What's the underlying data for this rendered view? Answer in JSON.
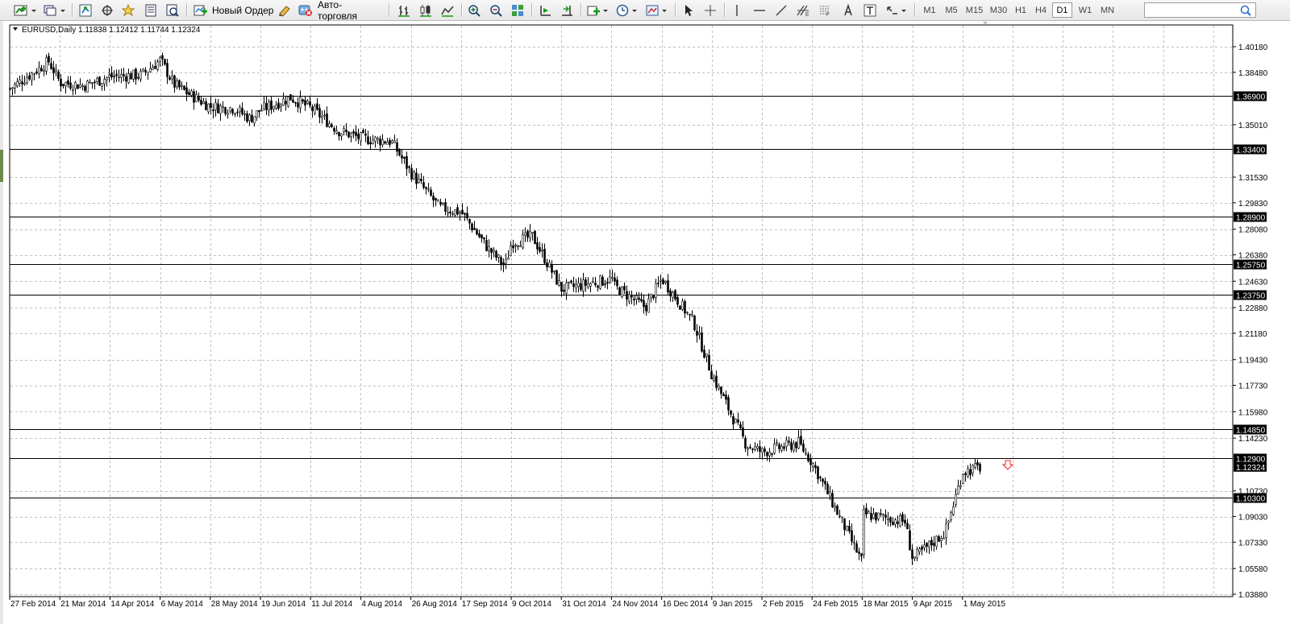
{
  "toolbar": {
    "new_order_label": "Новый Ордер",
    "autotrading_label": "Авто-торговля",
    "timeframes": [
      "M1",
      "M5",
      "M15",
      "M30",
      "H1",
      "H4",
      "D1",
      "W1",
      "MN"
    ],
    "active_timeframe": "D1",
    "icons": [
      "new-chart-icon",
      "profiles-icon",
      "market-watch-icon",
      "navigator-icon",
      "favorites-icon",
      "data-window-icon",
      "strategy-tester-icon",
      "new-order-icon",
      "metaeditor-icon",
      "autotrading-icon",
      "bar-chart-icon",
      "candlestick-icon",
      "line-chart-icon",
      "zoom-in-icon",
      "zoom-out-icon",
      "tile-windows-icon",
      "chart-shift-icon",
      "autoscroll-icon",
      "indicators-icon",
      "periods-icon",
      "templates-icon",
      "cursor-icon",
      "crosshair-icon",
      "vertical-line-icon",
      "horizontal-line-icon",
      "trendline-icon",
      "fibonacci-icon",
      "gridlines-icon",
      "text-icon",
      "text-label-icon",
      "arrows-icon",
      "search-icon"
    ]
  },
  "chart": {
    "symbol_info": "EURUSD,Daily  1.11838 1.12412 1.11744 1.12324",
    "x_labels": [
      "27 Feb 2014",
      "21 Mar 2014",
      "14 Apr 2014",
      "6 May 2014",
      "28 May 2014",
      "19 Jun 2014",
      "11 Jul 2014",
      "4 Aug 2014",
      "26 Aug 2014",
      "17 Sep 2014",
      "9 Oct 2014",
      "31 Oct 2014",
      "24 Nov 2014",
      "16 Dec 2014",
      "9 Jan 2015",
      "2 Feb 2015",
      "24 Feb 2015",
      "18 Mar 2015",
      "9 Apr 2015",
      "1 May 2015"
    ],
    "current_price": "1.12324",
    "colors": {
      "candle": "#000000",
      "background": "#ffffff",
      "grid": "#c0c0c0",
      "sell_arrow": "#ff0000"
    }
  },
  "chart_data": {
    "type": "candlestick",
    "symbol": "EURUSD",
    "timeframe": "Daily",
    "ohlc_last": {
      "open": 1.11838,
      "high": 1.12412,
      "low": 1.11744,
      "close": 1.12324
    },
    "ylim": [
      1.0388,
      1.4018
    ],
    "y_ticks": [
      1.4018,
      1.3848,
      1.3501,
      1.3153,
      1.2983,
      1.2808,
      1.2638,
      1.2463,
      1.2288,
      1.2118,
      1.1943,
      1.1773,
      1.1598,
      1.1423,
      1.1073,
      1.0903,
      1.0733,
      1.0558,
      1.0388
    ],
    "y_tick_labels": [
      "1.40180",
      "1.38480",
      "1.35010",
      "1.31530",
      "1.29830",
      "1.28080",
      "1.26380",
      "1.24630",
      "1.22880",
      "1.21180",
      "1.19430",
      "1.17730",
      "1.15980",
      "1.14230",
      "1.10730",
      "1.09030",
      "1.07330",
      "1.05580",
      "1.03880"
    ],
    "horizontal_levels": [
      1.369,
      1.334,
      1.289,
      1.2575,
      1.2375,
      1.1485,
      1.129,
      1.103
    ],
    "level_labels": [
      "1.36900",
      "1.33400",
      "1.28900",
      "1.25750",
      "1.23750",
      "1.14850",
      "1.12900",
      "1.10300"
    ],
    "close_path": [
      {
        "date": "27 Feb 2014",
        "close": 1.374
      },
      {
        "date": "14 Mar 2014",
        "close": 1.392
      },
      {
        "date": "21 Mar 2014",
        "close": 1.378
      },
      {
        "date": "1 Apr 2014",
        "close": 1.376
      },
      {
        "date": "14 Apr 2014",
        "close": 1.382
      },
      {
        "date": "24 Apr 2014",
        "close": 1.383
      },
      {
        "date": "6 May 2014",
        "close": 1.393
      },
      {
        "date": "9 May 2014",
        "close": 1.377
      },
      {
        "date": "19 May 2014",
        "close": 1.37
      },
      {
        "date": "28 May 2014",
        "close": 1.362
      },
      {
        "date": "6 Jun 2014",
        "close": 1.361
      },
      {
        "date": "12 Jun 2014",
        "close": 1.354
      },
      {
        "date": "19 Jun 2014",
        "close": 1.36
      },
      {
        "date": "1 Jul 2014",
        "close": 1.368
      },
      {
        "date": "11 Jul 2014",
        "close": 1.361
      },
      {
        "date": "23 Jul 2014",
        "close": 1.346
      },
      {
        "date": "4 Aug 2014",
        "close": 1.341
      },
      {
        "date": "15 Aug 2014",
        "close": 1.339
      },
      {
        "date": "26 Aug 2014",
        "close": 1.318
      },
      {
        "date": "5 Sep 2014",
        "close": 1.295
      },
      {
        "date": "17 Sep 2014",
        "close": 1.292
      },
      {
        "date": "26 Sep 2014",
        "close": 1.268
      },
      {
        "date": "3 Oct 2014",
        "close": 1.256
      },
      {
        "date": "9 Oct 2014",
        "close": 1.272
      },
      {
        "date": "17 Oct 2014",
        "close": 1.276
      },
      {
        "date": "31 Oct 2014",
        "close": 1.241
      },
      {
        "date": "14 Nov 2014",
        "close": 1.248
      },
      {
        "date": "24 Nov 2014",
        "close": 1.244
      },
      {
        "date": "5 Dec 2014",
        "close": 1.229
      },
      {
        "date": "16 Dec 2014",
        "close": 1.248
      },
      {
        "date": "26 Dec 2014",
        "close": 1.219
      },
      {
        "date": "9 Jan 2015",
        "close": 1.184
      },
      {
        "date": "22 Jan 2015",
        "close": 1.138
      },
      {
        "date": "2 Feb 2015",
        "close": 1.133
      },
      {
        "date": "16 Feb 2015",
        "close": 1.139
      },
      {
        "date": "24 Feb 2015",
        "close": 1.126
      },
      {
        "date": "11 Mar 2015",
        "close": 1.061
      },
      {
        "date": "18 Mar 2015",
        "close": 1.092
      },
      {
        "date": "26 Mar 2015",
        "close": 1.087
      },
      {
        "date": "9 Apr 2015",
        "close": 1.062
      },
      {
        "date": "17 Apr 2015",
        "close": 1.08
      },
      {
        "date": "1 May 2015",
        "close": 1.12
      },
      {
        "date": "7 May 2015",
        "close": 1.1232
      }
    ]
  }
}
